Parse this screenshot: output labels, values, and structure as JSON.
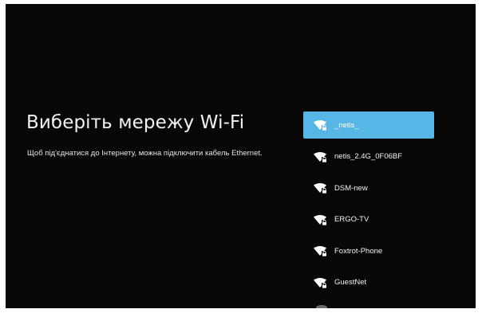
{
  "setup": {
    "title": "Виберіть мережу Wi-Fi",
    "subtitle": "Щоб під'єднатися до Інтернету, можна підключити кабель Ethernet."
  },
  "networks": {
    "items": [
      {
        "ssid": "_netis_",
        "selected": true,
        "icon": "wifi-locked-icon"
      },
      {
        "ssid": "netis_2.4G_0F06BF",
        "selected": false,
        "icon": "wifi-locked-icon"
      },
      {
        "ssid": "DSM-new",
        "selected": false,
        "icon": "wifi-locked-icon"
      },
      {
        "ssid": "ERGO-TV",
        "selected": false,
        "icon": "wifi-locked-icon"
      },
      {
        "ssid": "Foxtrot-Phone",
        "selected": false,
        "icon": "wifi-locked-icon"
      },
      {
        "ssid": "GuestNet",
        "selected": false,
        "icon": "wifi-locked-icon"
      }
    ]
  },
  "colors": {
    "background": "#070707",
    "highlight": "#58b6e6",
    "text": "#f4f4f4"
  }
}
